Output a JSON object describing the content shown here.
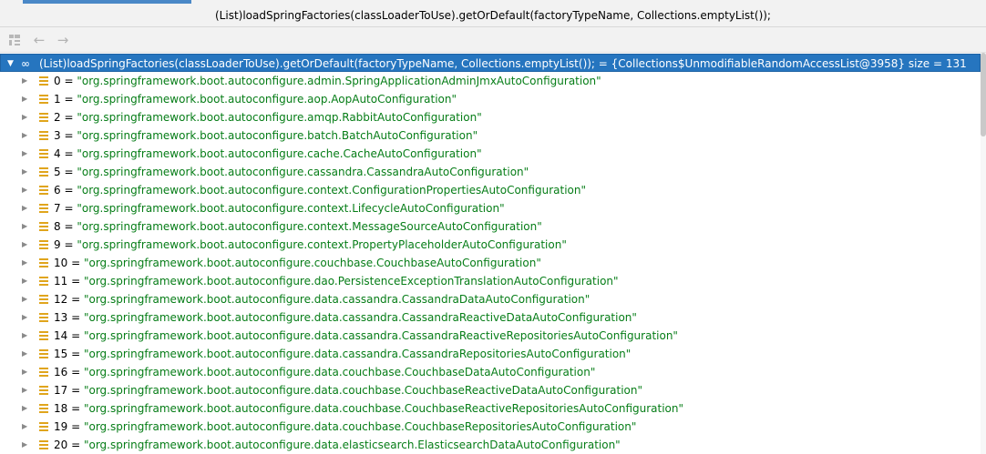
{
  "expression": "(List)loadSpringFactories(classLoaderToUse).getOrDefault(factoryTypeName, Collections.emptyList());",
  "root": {
    "text": "(List)loadSpringFactories(classLoaderToUse).getOrDefault(factoryTypeName, Collections.emptyList()); = {Collections$UnmodifiableRandomAccessList@3958}  size = 131"
  },
  "items": [
    {
      "index": "0 = ",
      "value": "\"org.springframework.boot.autoconfigure.admin.SpringApplicationAdminJmxAutoConfiguration\""
    },
    {
      "index": "1 = ",
      "value": "\"org.springframework.boot.autoconfigure.aop.AopAutoConfiguration\""
    },
    {
      "index": "2 = ",
      "value": "\"org.springframework.boot.autoconfigure.amqp.RabbitAutoConfiguration\""
    },
    {
      "index": "3 = ",
      "value": "\"org.springframework.boot.autoconfigure.batch.BatchAutoConfiguration\""
    },
    {
      "index": "4 = ",
      "value": "\"org.springframework.boot.autoconfigure.cache.CacheAutoConfiguration\""
    },
    {
      "index": "5 = ",
      "value": "\"org.springframework.boot.autoconfigure.cassandra.CassandraAutoConfiguration\""
    },
    {
      "index": "6 = ",
      "value": "\"org.springframework.boot.autoconfigure.context.ConfigurationPropertiesAutoConfiguration\""
    },
    {
      "index": "7 = ",
      "value": "\"org.springframework.boot.autoconfigure.context.LifecycleAutoConfiguration\""
    },
    {
      "index": "8 = ",
      "value": "\"org.springframework.boot.autoconfigure.context.MessageSourceAutoConfiguration\""
    },
    {
      "index": "9 = ",
      "value": "\"org.springframework.boot.autoconfigure.context.PropertyPlaceholderAutoConfiguration\""
    },
    {
      "index": "10 = ",
      "value": "\"org.springframework.boot.autoconfigure.couchbase.CouchbaseAutoConfiguration\""
    },
    {
      "index": "11 = ",
      "value": "\"org.springframework.boot.autoconfigure.dao.PersistenceExceptionTranslationAutoConfiguration\""
    },
    {
      "index": "12 = ",
      "value": "\"org.springframework.boot.autoconfigure.data.cassandra.CassandraDataAutoConfiguration\""
    },
    {
      "index": "13 = ",
      "value": "\"org.springframework.boot.autoconfigure.data.cassandra.CassandraReactiveDataAutoConfiguration\""
    },
    {
      "index": "14 = ",
      "value": "\"org.springframework.boot.autoconfigure.data.cassandra.CassandraReactiveRepositoriesAutoConfiguration\""
    },
    {
      "index": "15 = ",
      "value": "\"org.springframework.boot.autoconfigure.data.cassandra.CassandraRepositoriesAutoConfiguration\""
    },
    {
      "index": "16 = ",
      "value": "\"org.springframework.boot.autoconfigure.data.couchbase.CouchbaseDataAutoConfiguration\""
    },
    {
      "index": "17 = ",
      "value": "\"org.springframework.boot.autoconfigure.data.couchbase.CouchbaseReactiveDataAutoConfiguration\""
    },
    {
      "index": "18 = ",
      "value": "\"org.springframework.boot.autoconfigure.data.couchbase.CouchbaseReactiveRepositoriesAutoConfiguration\""
    },
    {
      "index": "19 = ",
      "value": "\"org.springframework.boot.autoconfigure.data.couchbase.CouchbaseRepositoriesAutoConfiguration\""
    },
    {
      "index": "20 = ",
      "value": "\"org.springframework.boot.autoconfigure.data.elasticsearch.ElasticsearchDataAutoConfiguration\""
    }
  ],
  "icons": {
    "tree_toggle": "tree-layout-icon",
    "back": "arrow-left-icon",
    "forward": "arrow-right-icon",
    "expand": "chevron-right-icon",
    "collapse": "chevron-down-icon",
    "infinity": "infinity-icon",
    "field": "field-icon"
  },
  "colors": {
    "selection": "#2675bf",
    "string_value": "#067d17",
    "field_icon": "#e0a51c"
  }
}
